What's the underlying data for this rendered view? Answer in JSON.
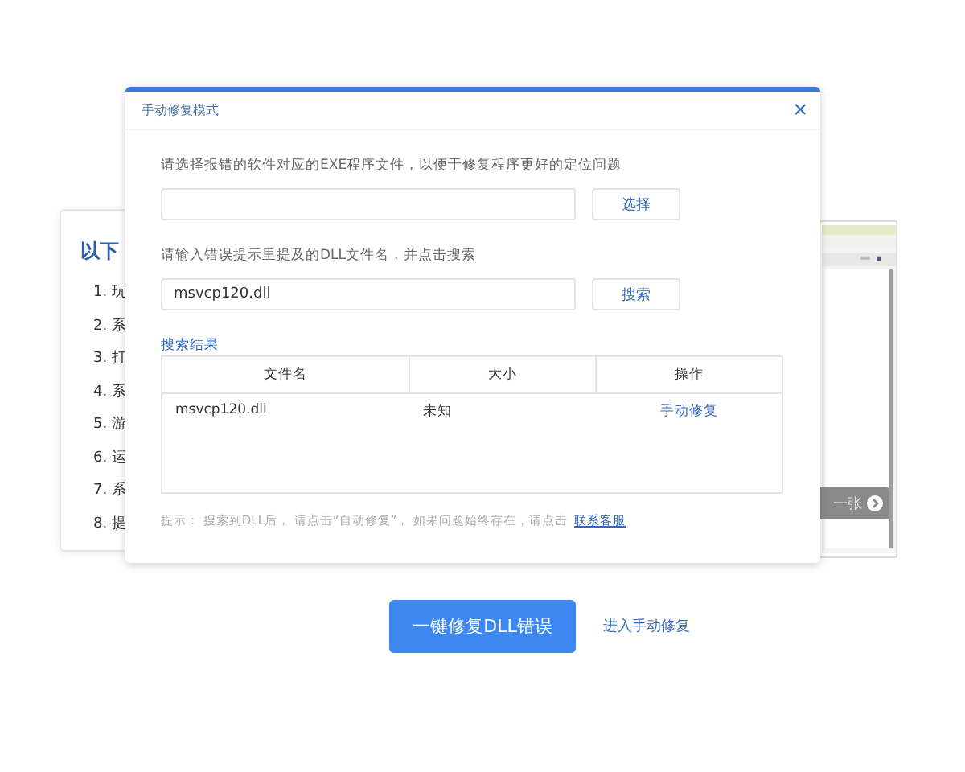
{
  "background_card": {
    "title": "以下",
    "items": [
      "1. 玩",
      "2. 系",
      "3. 打",
      "4. 系",
      "5. 游",
      "6. 运",
      "7. 系",
      "8. 提"
    ]
  },
  "preview_card": {
    "kind": "picture",
    "next_button": "一张"
  },
  "dialog": {
    "title": "手动修复模式",
    "close": "×",
    "exe_label": "请选择报错的软件对应的EXE程序文件，以便于修复程序更好的定位问题",
    "choose_button": "选择",
    "dll_label": "请输入错误提示里提及的DLL文件名，并点击搜索",
    "dll_field": {
      "value": "msvcp120.dll"
    },
    "search_button": "搜索",
    "results_title": "搜索结果",
    "table": {
      "columns": [
        "文件名",
        "大小",
        "操作"
      ],
      "rows": [
        {
          "file": "msvcp120.dll",
          "size": "未知",
          "action": "手动修复"
        }
      ]
    },
    "hint": "提示：  搜索到DLL后，  请点击“自动修复”，  如果问题始终存在，请点击",
    "hint_link": "联系客服"
  },
  "primary_button": "一键修复DLL错误",
  "manual_link": "进入手动修复"
}
